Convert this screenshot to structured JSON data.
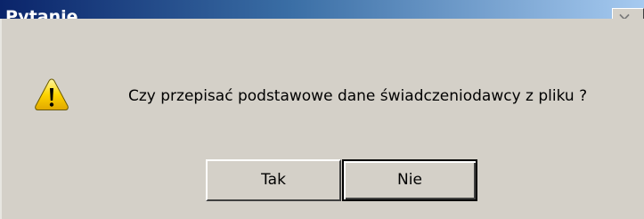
{
  "window": {
    "title": "Pytanie",
    "close_glyph": "×",
    "close_icon": "close-icon"
  },
  "message": {
    "text": "Czy przepisać podstawowe dane świadczeniodawcy z pliku ?",
    "icon": "warning-icon"
  },
  "buttons": {
    "yes_label": "Tak",
    "no_label": "Nie",
    "default": "Nie"
  },
  "colors": {
    "titlebar_start": "#0a246a",
    "titlebar_end": "#a6caf0",
    "dialog_bg": "#d4d0c8",
    "warning_yellow": "#ffd400"
  }
}
